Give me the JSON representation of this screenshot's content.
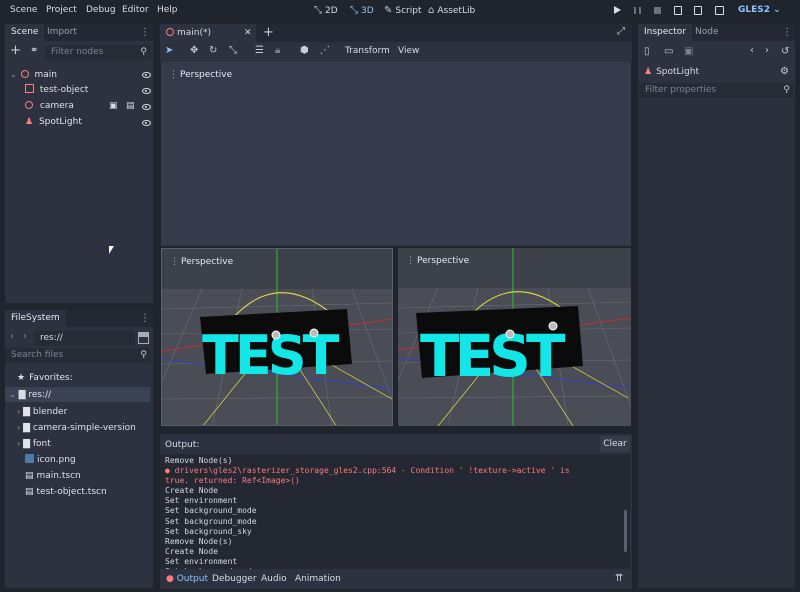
{
  "menu": [
    "Scene",
    "Project",
    "Debug",
    "Editor",
    "Help"
  ],
  "workspaces": [
    {
      "label": "2D",
      "icon": "2d-icon"
    },
    {
      "label": "3D",
      "icon": "3d-icon"
    },
    {
      "label": "Script",
      "icon": "script-icon"
    },
    {
      "label": "AssetLib",
      "icon": "assetlib-icon"
    }
  ],
  "renderer": "GLES2",
  "scene_dock": {
    "tabs": [
      "Scene",
      "Import"
    ],
    "filter_placeholder": "Filter nodes",
    "nodes": [
      {
        "label": "main"
      },
      {
        "label": "test-object"
      },
      {
        "label": "camera"
      },
      {
        "label": "SpotLight"
      }
    ]
  },
  "filesystem": {
    "tab": "FileSystem",
    "path": "res://",
    "search_placeholder": "Search files",
    "items": [
      {
        "label": "Favorites:"
      },
      {
        "label": "res://"
      },
      {
        "label": "blender"
      },
      {
        "label": "camera-simple-version"
      },
      {
        "label": "font"
      },
      {
        "label": "icon.png"
      },
      {
        "label": "main.tscn"
      },
      {
        "label": "test-object.tscn"
      }
    ]
  },
  "editor": {
    "tab": "main(*)",
    "toolbar": {
      "transform": "Transform",
      "view": "View"
    },
    "viewports": [
      "Perspective",
      "Perspective",
      "Perspective"
    ]
  },
  "output": {
    "title": "Output:",
    "clear": "Clear",
    "lines": [
      {
        "text": "Remove Node(s)",
        "err": false
      },
      {
        "text": "● drivers\\gles2\\rasterizer_storage_gles2.cpp:564 - Condition ' !texture->active ' is",
        "err": true
      },
      {
        "text": "true. returned: Ref<Image>()",
        "err": true
      },
      {
        "text": "Create Node",
        "err": false
      },
      {
        "text": "Set environment",
        "err": false
      },
      {
        "text": "Set background_mode",
        "err": false
      },
      {
        "text": "Set background_mode",
        "err": false
      },
      {
        "text": "Set background_sky",
        "err": false
      },
      {
        "text": "Remove Node(s)",
        "err": false
      },
      {
        "text": "Create Node",
        "err": false
      },
      {
        "text": "Set environment",
        "err": false
      },
      {
        "text": "Set background_mode",
        "err": false
      }
    ],
    "tabs": [
      "Output",
      "Debugger",
      "Audio",
      "Animation"
    ]
  },
  "inspector": {
    "tabs": [
      "Inspector",
      "Node"
    ],
    "object": "SpotLight",
    "filter_placeholder": "Filter properties"
  },
  "viewport_text": "TEST",
  "colors": {
    "accent": "#8cc2ff",
    "node3d": "#fc7f7f",
    "error": "#ff7a7a"
  }
}
